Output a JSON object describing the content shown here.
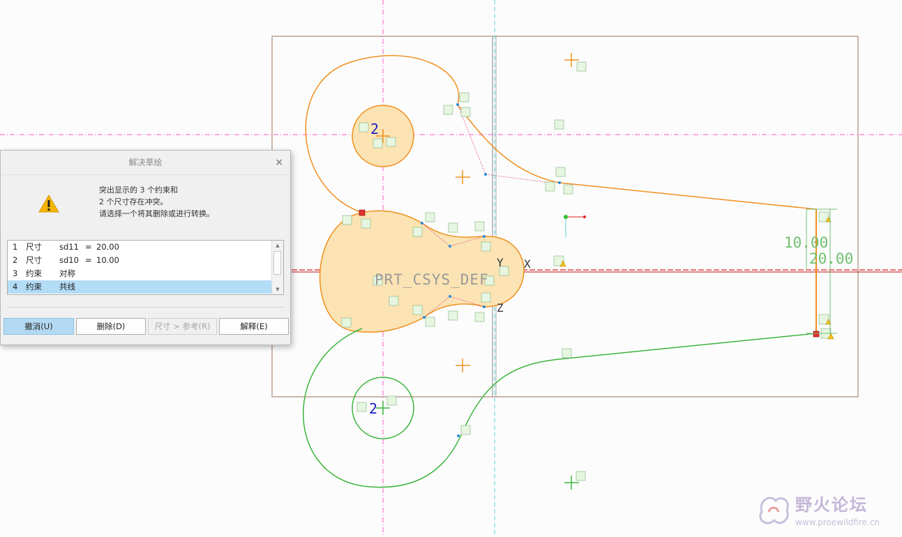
{
  "dialog": {
    "title": "解决草绘",
    "close": "×",
    "message": [
      "突出显示的 3 个约束和",
      "2 个尺寸存在冲突。",
      "请选择一个将其删除或进行转换。"
    ],
    "items": [
      {
        "no": "1",
        "kind": "尺寸",
        "name": "sd11",
        "eq": "=",
        "value": "20.00",
        "selected": false
      },
      {
        "no": "2",
        "kind": "尺寸",
        "name": "sd10",
        "eq": "=",
        "value": "10.00",
        "selected": false
      },
      {
        "no": "3",
        "kind": "约束",
        "name": "对称",
        "eq": "",
        "value": "",
        "selected": false
      },
      {
        "no": "4",
        "kind": "约束",
        "name": "共线",
        "eq": "",
        "value": "",
        "selected": true
      }
    ],
    "buttons": {
      "undo": "撤消(U)",
      "delete": "删除(D)",
      "convert": "尺寸 > 参考(R)",
      "explain": "解释(E)"
    }
  },
  "sketch": {
    "csys_label": "PRT_CSYS_DEF",
    "axis_x": "X",
    "axis_y": "Y",
    "axis_z": "Z",
    "dim_10": "10.00",
    "dim_20": "20.00",
    "equal_2_top": "2",
    "equal_2_bottom": "2",
    "colors": {
      "orange": "#f0901e",
      "green": "#3cb43c",
      "fill": "#fbe3b3",
      "frame": "#a0705a",
      "centerline_pink": "#ff58c8",
      "dim": "#6fbf6f",
      "axis_red": "#e02020"
    }
  },
  "watermark": {
    "name": "野火论坛",
    "url": "www.proewildfire.cn"
  }
}
